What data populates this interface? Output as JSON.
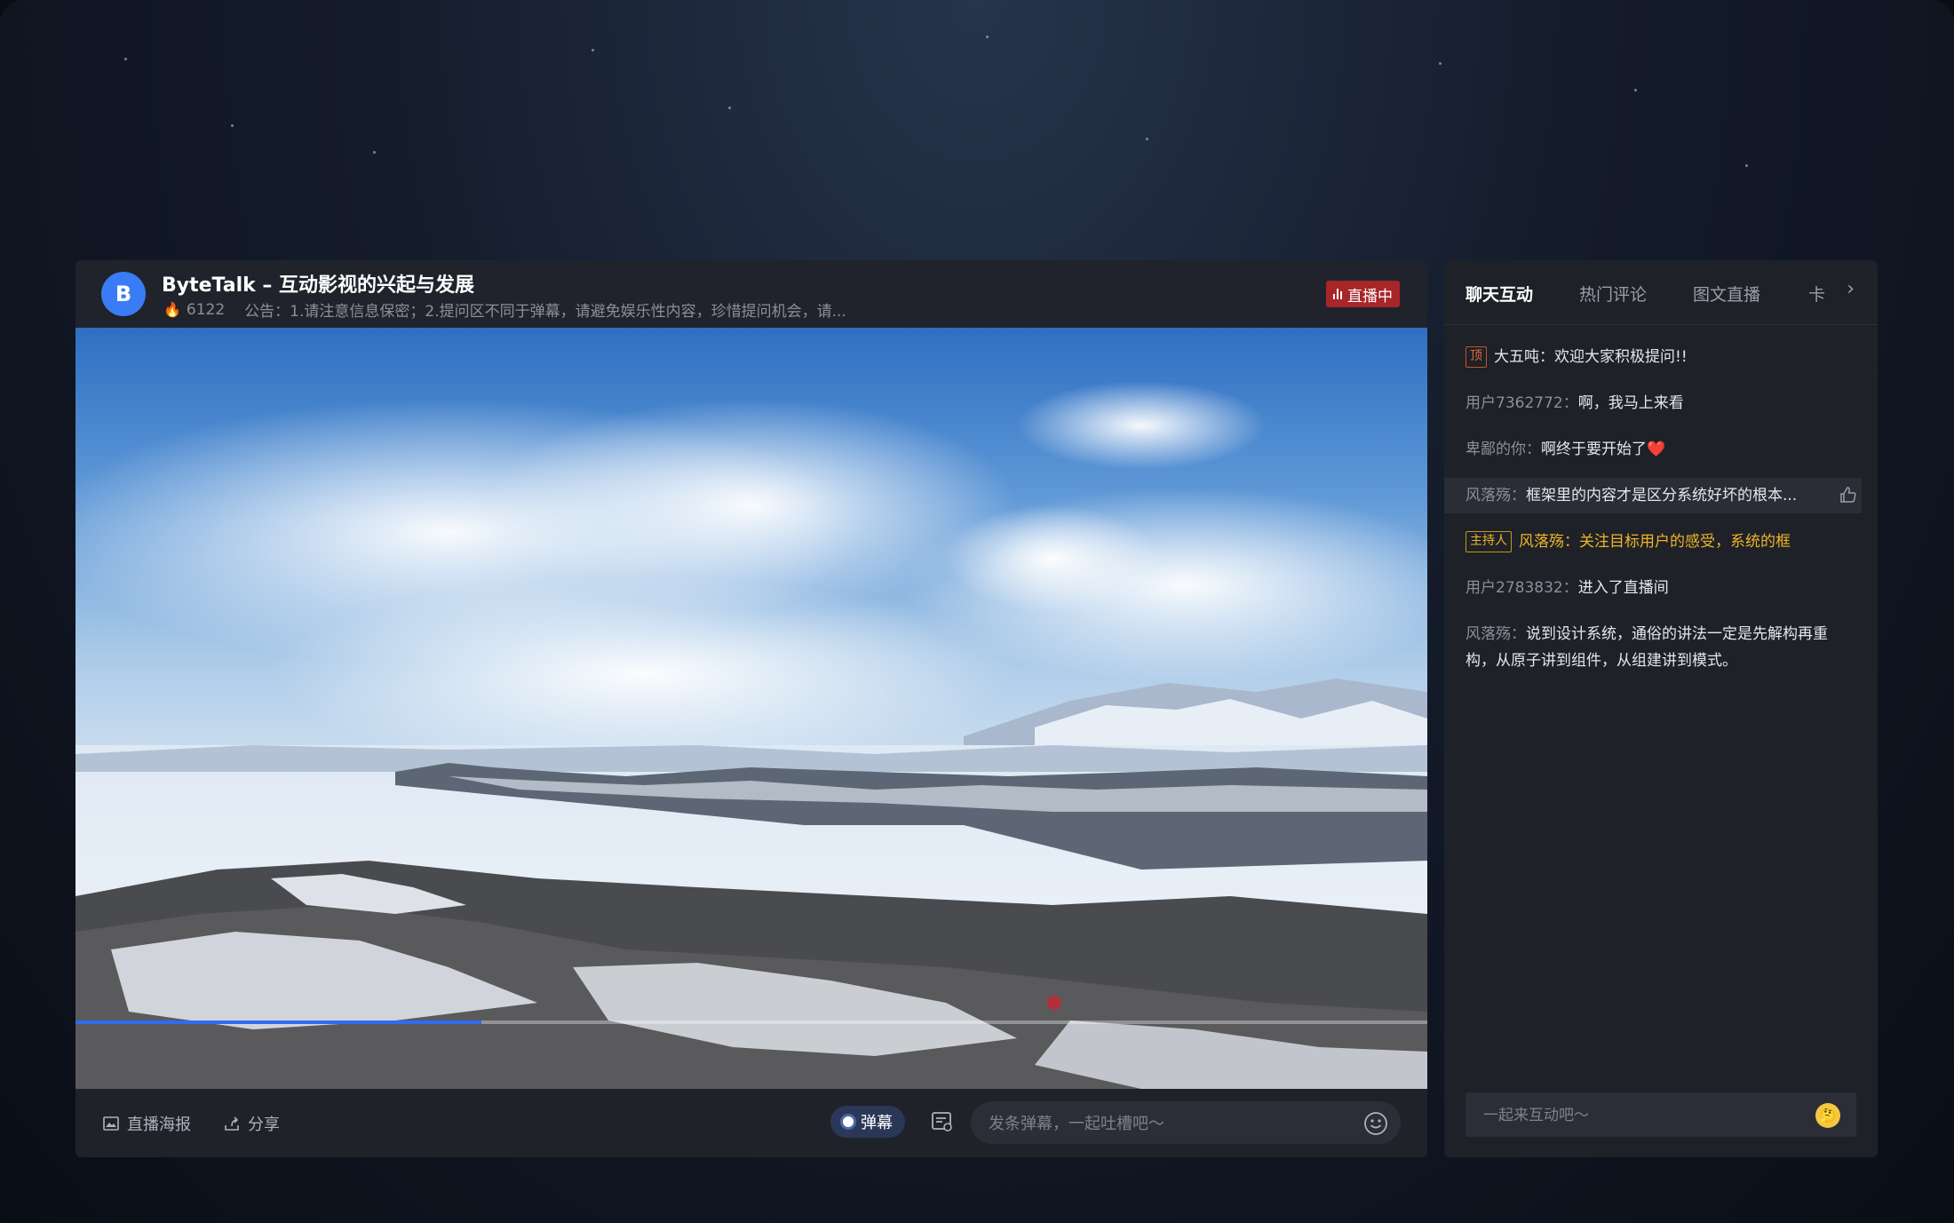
{
  "header": {
    "avatar_letter": "B",
    "title": "ByteTalk – 互动影视的兴起与发展",
    "viewer_count": "6122",
    "notice": "公告：1.请注意信息保密；2.提问区不同于弹幕，请避免娱乐性内容，珍惜提问机会，请...",
    "live_badge": "直播中",
    "live_color": "#a82528"
  },
  "video": {
    "progress": 0.3
  },
  "footer": {
    "poster_label": "直播海报",
    "share_label": "分享",
    "danmaku_toggle_label": "弹幕",
    "danmaku_placeholder": "发条弹幕，一起吐槽吧～"
  },
  "chat": {
    "tabs": [
      {
        "label": "聊天互动",
        "active": true
      },
      {
        "label": "热门评论"
      },
      {
        "label": "图文直播"
      },
      {
        "label": "卡"
      }
    ],
    "messages": [
      {
        "tag": "顶",
        "user": "大五吨",
        "text": "欢迎大家积极提问!!"
      },
      {
        "user": "用户7362772",
        "text": "啊，我马上来看"
      },
      {
        "user": "卑鄙的你",
        "text": "啊终于要开始了❤️"
      },
      {
        "user": "风落殇",
        "text": "框架里的内容才是区分系统好坏的根本..."
      },
      {
        "tag": "主持人",
        "user": "风落殇",
        "text": "关注目标用户的感受，系统的框"
      },
      {
        "user": "用户2783832",
        "text": "进入了直播间"
      },
      {
        "user": "风落殇",
        "text": "说到设计系统，通俗的讲法一定是先解构再重构，从原子讲到组件，从组建讲到模式。"
      }
    ],
    "input_placeholder": "一起来互动吧～"
  }
}
